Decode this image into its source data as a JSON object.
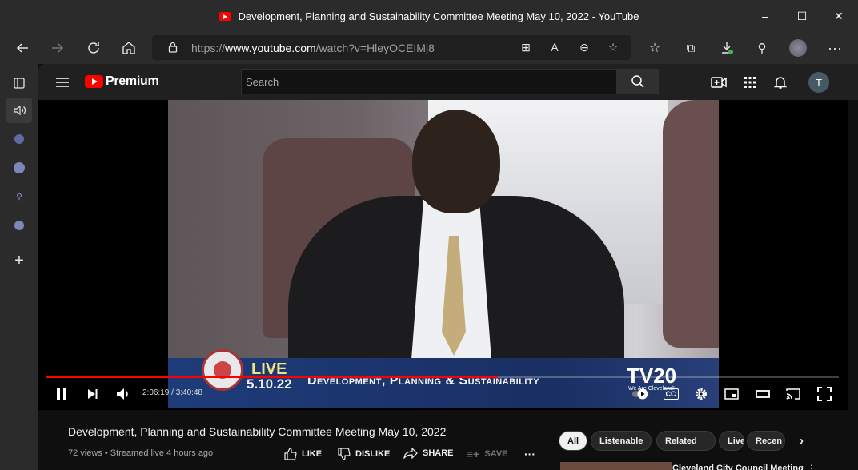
{
  "window": {
    "title": "Development, Planning and Sustainability Committee Meeting May 10, 2022 - YouTube",
    "minimize": "–",
    "maximize": "☐",
    "close": "✕"
  },
  "toolbar": {
    "url_scheme": "https://",
    "url_host": "www.youtube.com",
    "url_path": "/watch?v=HleyOCEIMj8",
    "icons": [
      "back-icon",
      "forward-icon",
      "refresh-icon",
      "home-icon",
      "lock-icon",
      "app-available-icon",
      "read-aloud-icon",
      "zoom-icon",
      "add-favorite-icon",
      "favorites-icon",
      "collections-icon",
      "downloads-icon",
      "extensions-icon",
      "profile-icon",
      "more-icon"
    ]
  },
  "sidebar": {
    "icons": [
      "tab-actions-icon",
      "speaker-icon",
      "tab-favicon-1",
      "tab-favicon-2",
      "tab-search-icon",
      "tab-favicon-3",
      "new-tab-icon"
    ]
  },
  "youtube": {
    "brand": "Premium",
    "search_placeholder": "Search",
    "avatar_letter": "T"
  },
  "player": {
    "lower_third_live": "LIVE",
    "lower_third_date": "5.10.22",
    "lower_third_title": "Development, Planning & Sustainability",
    "station": "TV20",
    "station_tagline": "We Are Cleveland!",
    "time_current": "2:06:19",
    "time_total": "3:40:48",
    "progress_fraction": 0.57,
    "accent": "#ff0000"
  },
  "video": {
    "title": "Development, Planning and Sustainability Committee Meeting May 10, 2022",
    "meta": "72 views • Streamed live 4 hours ago",
    "like": "LIKE",
    "dislike": "DISLIKE",
    "share": "SHARE",
    "save": "SAVE"
  },
  "chips": [
    "All",
    "Listenable",
    "Related",
    "Live",
    "Recen"
  ],
  "next": {
    "title": "Cleveland City Council Meeting"
  }
}
